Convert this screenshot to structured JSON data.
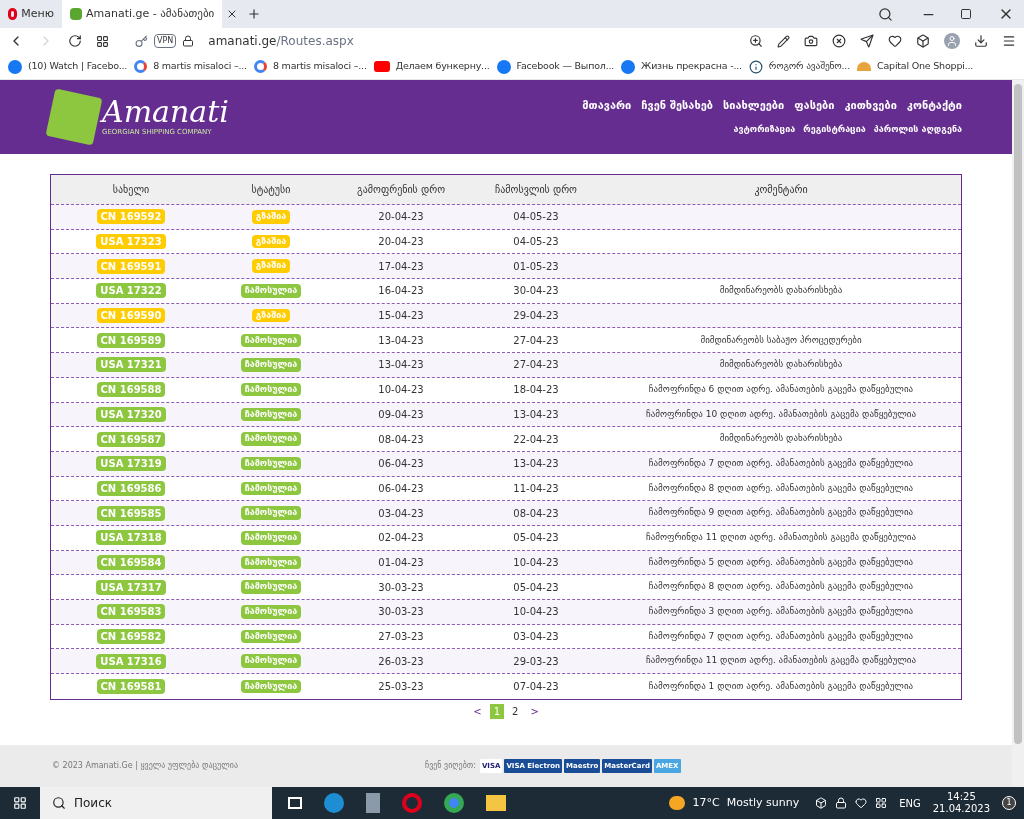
{
  "browser": {
    "menu_label": "Меню",
    "tab_title": "Amanati.ge - ამანათები",
    "url_host": "amanati.ge",
    "url_path": "/Routes.aspx",
    "vpn_label": "VPN",
    "bookmarks": [
      {
        "label": "(10) Watch | Facebo...",
        "kind": "facebook"
      },
      {
        "label": "8 martis misaloci –...",
        "kind": "google"
      },
      {
        "label": "8 martis misaloci –...",
        "kind": "google"
      },
      {
        "label": "Делаем бункерну...",
        "kind": "youtube"
      },
      {
        "label": "Facebook — Выпол...",
        "kind": "facebook"
      },
      {
        "label": "Жизнь прекрасна -...",
        "kind": "facebook"
      },
      {
        "label": "როგორ ავაშენო...",
        "kind": "info"
      },
      {
        "label": "Capital One Shoppi...",
        "kind": "shop"
      }
    ]
  },
  "site": {
    "logo_text": "Amanati",
    "logo_tagline": "GEORGIAN SHIPPING COMPANY",
    "nav": [
      "მთავარი",
      "ჩვენ შესახებ",
      "სიახლეები",
      "ფასები",
      "კითხვები",
      "კონტაქტი"
    ],
    "sub_nav": [
      "ავტორიზაცია",
      "რეგისტრაცია",
      "პაროლის აღდგენა"
    ]
  },
  "table": {
    "columns": [
      "სახელი",
      "სტატუსი",
      "გამოფრენის დრო",
      "ჩამოსვლის დრო",
      "კომენტარი"
    ],
    "rows": [
      {
        "name": "CN 169592",
        "status": "გზაშია",
        "kind": "transit",
        "departure": "20-04-23",
        "arrival": "04-05-23"
      },
      {
        "name": "USA 17323",
        "status": "გზაშია",
        "kind": "transit",
        "departure": "20-04-23",
        "arrival": "04-05-23"
      },
      {
        "name": "CN 169591",
        "status": "გზაშია",
        "kind": "transit",
        "departure": "17-04-23",
        "arrival": "01-05-23"
      },
      {
        "name": "USA 17322",
        "status": "ჩამოსულია",
        "kind": "arrived",
        "departure": "16-04-23",
        "arrival": "30-04-23",
        "comment": "მიმდინარეობს დახარისხება"
      },
      {
        "name": "CN 169590",
        "status": "გზაშია",
        "kind": "transit",
        "departure": "15-04-23",
        "arrival": "29-04-23"
      },
      {
        "name": "CN 169589",
        "status": "ჩამოსულია",
        "kind": "arrived",
        "departure": "13-04-23",
        "arrival": "27-04-23",
        "comment": "მიმდინარეობს საბაჟო პროცედურები"
      },
      {
        "name": "USA 17321",
        "status": "ჩამოსულია",
        "kind": "arrived",
        "departure": "13-04-23",
        "arrival": "27-04-23",
        "comment": "მიმდინარეობს დახარისხება"
      },
      {
        "name": "CN 169588",
        "status": "ჩამოსულია",
        "kind": "arrived",
        "departure": "10-04-23",
        "arrival": "18-04-23",
        "comment": "ჩამოფრინდა 6 დღით ადრე. ამანათების გაცემა დაწყებულია"
      },
      {
        "name": "USA 17320",
        "status": "ჩამოსულია",
        "kind": "arrived",
        "departure": "09-04-23",
        "arrival": "13-04-23",
        "comment": "ჩამოფრინდა 10 დღით ადრე. ამანათების გაცემა დაწყებულია"
      },
      {
        "name": "CN 169587",
        "status": "ჩამოსულია",
        "kind": "arrived",
        "departure": "08-04-23",
        "arrival": "22-04-23",
        "comment": "მიმდინარეობს დახარისხება"
      },
      {
        "name": "USA 17319",
        "status": "ჩამოსულია",
        "kind": "arrived",
        "departure": "06-04-23",
        "arrival": "13-04-23",
        "comment": "ჩამოფრინდა 7 დღით ადრე. ამანათების გაცემა დაწყებულია"
      },
      {
        "name": "CN 169586",
        "status": "ჩამოსულია",
        "kind": "arrived",
        "departure": "06-04-23",
        "arrival": "11-04-23",
        "comment": "ჩამოფრინდა 8 დღით ადრე. ამანათების გაცემა დაწყებულია"
      },
      {
        "name": "CN 169585",
        "status": "ჩამოსულია",
        "kind": "arrived",
        "departure": "03-04-23",
        "arrival": "08-04-23",
        "comment": "ჩამოფრინდა 9 დღით ადრე. ამანათების გაცემა დაწყებულია"
      },
      {
        "name": "USA 17318",
        "status": "ჩამოსულია",
        "kind": "arrived",
        "departure": "02-04-23",
        "arrival": "05-04-23",
        "comment": "ჩამოფრინდა 11 დღით ადრე. ამანათების გაცემა დაწყებულია"
      },
      {
        "name": "CN 169584",
        "status": "ჩამოსულია",
        "kind": "arrived",
        "departure": "01-04-23",
        "arrival": "10-04-23",
        "comment": "ჩამოფრინდა 5 დღით ადრე. ამანათების გაცემა დაწყებულია"
      },
      {
        "name": "USA 17317",
        "status": "ჩამოსულია",
        "kind": "arrived",
        "departure": "30-03-23",
        "arrival": "05-04-23",
        "comment": "ჩამოფრინდა 8 დღით ადრე. ამანათების გაცემა დაწყებულია"
      },
      {
        "name": "CN 169583",
        "status": "ჩამოსულია",
        "kind": "arrived",
        "departure": "30-03-23",
        "arrival": "10-04-23",
        "comment": "ჩამოფრინდა 3 დღით ადრე. ამანათების გაცემა დაწყებულია"
      },
      {
        "name": "CN 169582",
        "status": "ჩამოსულია",
        "kind": "arrived",
        "departure": "27-03-23",
        "arrival": "03-04-23",
        "comment": "ჩამოფრინდა 7 დღით ადრე. ამანათების გაცემა დაწყებულია"
      },
      {
        "name": "USA 17316",
        "status": "ჩამოსულია",
        "kind": "arrived",
        "departure": "26-03-23",
        "arrival": "29-03-23",
        "comment": "ჩამოფრინდა 11 დღით ადრე. ამანათების გაცემა დაწყებულია"
      },
      {
        "name": "CN 169581",
        "status": "ჩამოსულია",
        "kind": "arrived",
        "departure": "25-03-23",
        "arrival": "07-04-23",
        "comment": "ჩამოფრინდა 1 დღით ადრე. ამანათების გაცემა დაწყებულია"
      }
    ]
  },
  "pagination": {
    "prev": "<",
    "next": ">",
    "pages": [
      {
        "label": "1",
        "selected": true
      },
      {
        "label": "2",
        "selected": false
      }
    ]
  },
  "footer": {
    "copyright": "© 2023 Amanati.Ge | ყველა უფლება დაცულია",
    "payments_label": "ჩვენ ვიღებთ:",
    "cards": [
      "VISA",
      "VISA Electron",
      "Maestro",
      "MasterCard",
      "AMEX"
    ]
  },
  "taskbar": {
    "search_placeholder": "Поиск",
    "weather": "17°C  Mostly sunny",
    "language": "ENG",
    "time": "14:25",
    "date": "21.04.2023",
    "notifications": "1"
  }
}
